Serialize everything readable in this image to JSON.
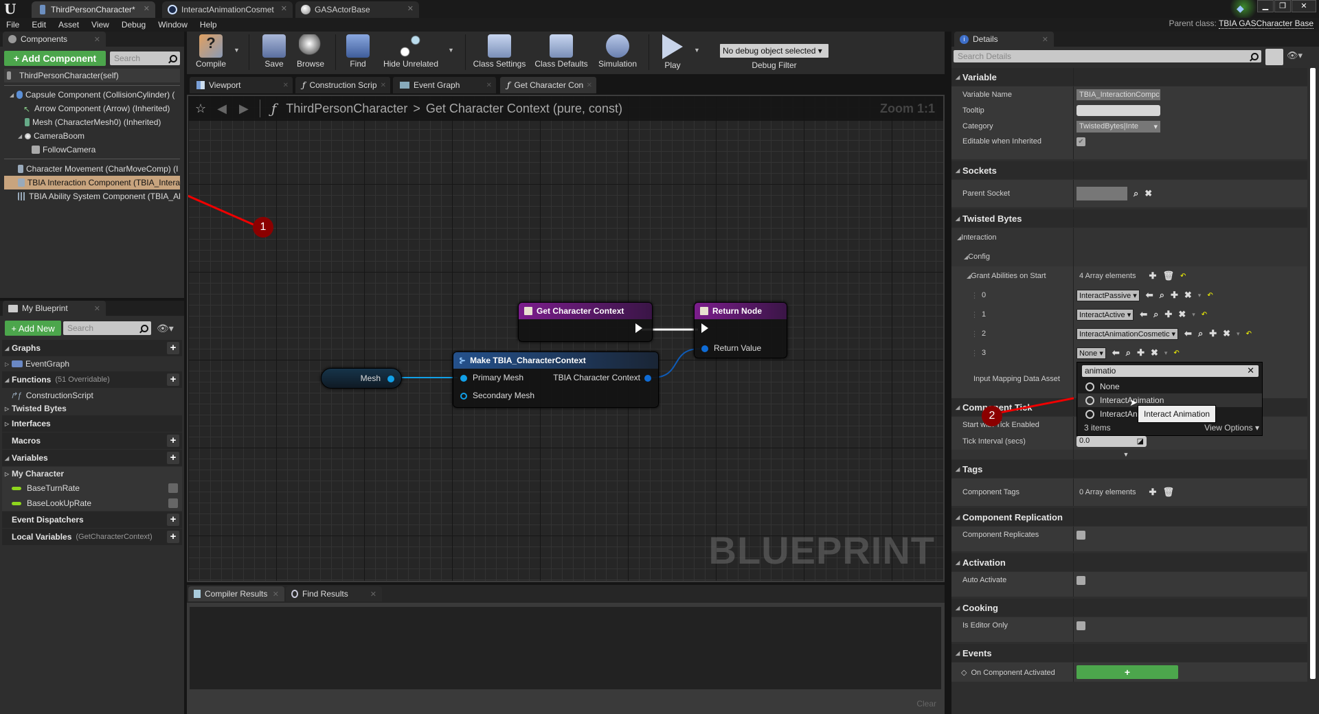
{
  "window": {
    "tabs": [
      {
        "label": "ThirdPersonCharacter*",
        "active": true
      },
      {
        "label": "InteractAnimationCosmet",
        "active": false
      },
      {
        "label": "GASActorBase",
        "active": false
      }
    ],
    "controls": {
      "minimize": "▁",
      "restore": "❐",
      "close": "✕"
    }
  },
  "menu": [
    "File",
    "Edit",
    "Asset",
    "View",
    "Debug",
    "Window",
    "Help"
  ],
  "parent_class": {
    "label": "Parent class:",
    "value": "TBIA GASCharacter Base"
  },
  "components_panel": {
    "tab": "Components",
    "add_button": "+ Add Component",
    "search_placeholder": "Search",
    "root": "ThirdPersonCharacter(self)",
    "items": [
      {
        "label": "Capsule Component (CollisionCylinder) (",
        "indent": 1,
        "expanded": true
      },
      {
        "label": "Arrow Component (Arrow) (Inherited)",
        "indent": 2
      },
      {
        "label": "Mesh (CharacterMesh0) (Inherited)",
        "indent": 2
      },
      {
        "label": "CameraBoom",
        "indent": 2,
        "expanded": true
      },
      {
        "label": "FollowCamera",
        "indent": 3
      },
      {
        "label": "Character Movement (CharMoveComp) (I",
        "indent": 1
      },
      {
        "label": "TBIA Interaction Component (TBIA_Intera",
        "indent": 1,
        "selected": true
      },
      {
        "label": "TBIA Ability System Component (TBIA_Al",
        "indent": 1
      }
    ]
  },
  "my_blueprint": {
    "tab": "My Blueprint",
    "add_button": "+ Add New",
    "search_placeholder": "Search",
    "sections": {
      "graphs": "Graphs",
      "event_graph": "EventGraph",
      "functions": "Functions",
      "functions_note": "(51 Overridable)",
      "construction_script": "ConstructionScript",
      "twisted_bytes": "Twisted Bytes",
      "interfaces": "Interfaces",
      "macros": "Macros",
      "variables": "Variables",
      "my_character": "My Character",
      "var1": "BaseTurnRate",
      "var2": "BaseLookUpRate",
      "event_dispatchers": "Event Dispatchers",
      "local_variables": "Local Variables",
      "local_variables_note": "(GetCharacterContext)"
    }
  },
  "toolbar": {
    "compile": "Compile",
    "save": "Save",
    "browse": "Browse",
    "find": "Find",
    "hide_unrelated": "Hide Unrelated",
    "class_settings": "Class Settings",
    "class_defaults": "Class Defaults",
    "simulation": "Simulation",
    "play": "Play",
    "debug_select": "No debug object selected",
    "debug_filter": "Debug Filter"
  },
  "graph_tabs": [
    {
      "label": "Viewport"
    },
    {
      "label": "Construction Scrip"
    },
    {
      "label": "Event Graph"
    },
    {
      "label": "Get Character Con",
      "active": true
    }
  ],
  "graph": {
    "breadcrumb_root": "ThirdPersonCharacter",
    "breadcrumb_sep": ">",
    "breadcrumb_current": "Get Character Context (pure, const)",
    "zoom": "Zoom 1:1",
    "watermark": "BLUEPRINT",
    "nodes": {
      "entry": {
        "title": "Get Character Context",
        "color": "#6b1a7a"
      },
      "return": {
        "title": "Return Node",
        "color": "#6b1a7a",
        "pin": "Return Value"
      },
      "make": {
        "title": "Make TBIA_CharacterContext",
        "color": "#1d3f6e",
        "in1": "Primary Mesh",
        "in2": "Secondary Mesh",
        "out": "TBIA Character Context"
      },
      "mesh": {
        "label": "Mesh"
      }
    },
    "markers": [
      "1",
      "2"
    ]
  },
  "bottom_panel": {
    "tabs": [
      "Compiler Results",
      "Find Results"
    ],
    "clear": "Clear"
  },
  "details": {
    "tab": "Details",
    "search_placeholder": "Search Details",
    "variable": {
      "header": "Variable",
      "name_label": "Variable Name",
      "name_value": "TBIA_InteractionCompc",
      "tooltip_label": "Tooltip",
      "tooltip_value": "",
      "category_label": "Category",
      "category_value": "TwistedBytes|Inte",
      "editable_label": "Editable when Inherited",
      "editable_checked": true
    },
    "sockets": {
      "header": "Sockets",
      "parent_label": "Parent Socket"
    },
    "twisted_bytes": {
      "header": "Twisted Bytes",
      "interaction": "Interaction",
      "config": "Config",
      "grant_label": "Grant Abilities on Start",
      "grant_count": "4 Array elements",
      "elements": [
        {
          "index": "0",
          "value": "InteractPassive"
        },
        {
          "index": "1",
          "value": "InteractActive"
        },
        {
          "index": "2",
          "value": "InteractAnimationCosmetic"
        },
        {
          "index": "3",
          "value": "None"
        }
      ],
      "input_mapping_label": "Input Mapping Data Asset"
    },
    "dropdown": {
      "filter": "animatio",
      "options": [
        "None",
        "InteractAnimation",
        "InteractAn"
      ],
      "highlighted": "InteractAnimation",
      "tooltip": "Interact Animation",
      "count": "3 items",
      "view_options": "View Options"
    },
    "component_tick": {
      "header": "Component Tick",
      "start_label": "Start with Tick Enabled",
      "start_checked": true,
      "interval_label": "Tick Interval (secs)",
      "interval_value": "0.0"
    },
    "tags": {
      "header": "Tags",
      "label": "Component Tags",
      "count": "0 Array elements"
    },
    "replication": {
      "header": "Component Replication",
      "label": "Component Replicates",
      "checked": false
    },
    "activation": {
      "header": "Activation",
      "label": "Auto Activate",
      "checked": false
    },
    "cooking": {
      "header": "Cooking",
      "label": "Is Editor Only",
      "checked": false
    },
    "events": {
      "header": "Events",
      "label": "On Component Activated",
      "add": "+"
    }
  }
}
